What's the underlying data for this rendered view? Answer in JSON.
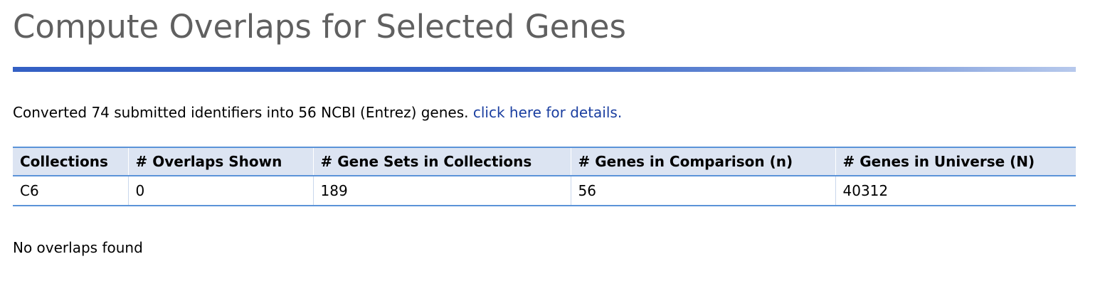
{
  "page": {
    "title": "Compute Overlaps for Selected Genes",
    "accent_color": "#3460c4"
  },
  "summary": {
    "text": "Converted 74 submitted identifiers into 56 NCBI (Entrez) genes.",
    "link_label": "click here for details."
  },
  "table": {
    "headers": [
      "Collections",
      "# Overlaps Shown",
      "# Gene Sets in Collections",
      "# Genes in Comparison (n)",
      "# Genes in Universe (N)"
    ],
    "rows": [
      [
        "C6",
        "0",
        "189",
        "56",
        "40312"
      ]
    ]
  },
  "result": {
    "message": "No overlaps found"
  }
}
